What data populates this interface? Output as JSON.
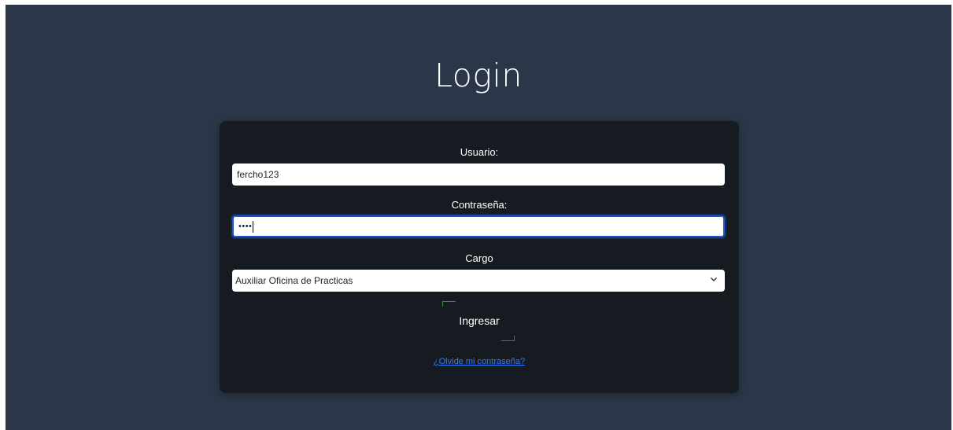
{
  "title": "Login",
  "form": {
    "username_label": "Usuario:",
    "username_value": "fercho123",
    "password_label": "Contraseña:",
    "password_value": "••••",
    "role_label": "Cargo",
    "role_value": "Auxiliar Oficina de Practicas",
    "submit_label": "Ingresar",
    "forgot_link": "¿Olvide mi contraseña?"
  },
  "colors": {
    "background": "#2b3748",
    "card": "#161b22",
    "link": "#2f7bff",
    "focus_ring": "#1f55c7",
    "button_corner_accent": "#1ea01e"
  },
  "icons": {
    "select_arrow": "chevron-down-icon"
  }
}
